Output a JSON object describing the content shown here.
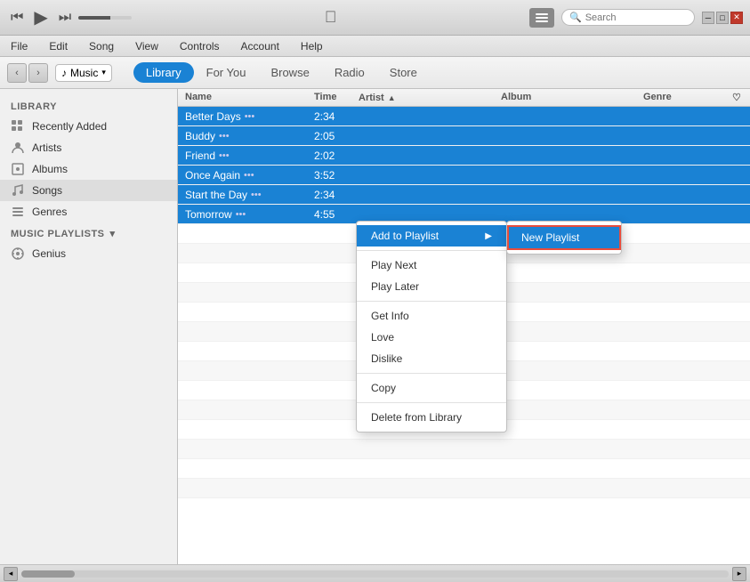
{
  "titlebar": {
    "transport": {
      "prev": "⏮",
      "play": "▶",
      "next": "⏭"
    },
    "apple_logo": "",
    "list_icon_label": "list",
    "search_placeholder": "Search"
  },
  "menubar": {
    "items": [
      "File",
      "Edit",
      "Song",
      "View",
      "Controls",
      "Account",
      "Help"
    ]
  },
  "navbar": {
    "nav_back": "‹",
    "nav_forward": "›",
    "source": "Music",
    "tabs": [
      "Library",
      "For You",
      "Browse",
      "Radio",
      "Store"
    ],
    "active_tab": "Library"
  },
  "sidebar": {
    "section_library": "Library",
    "items": [
      {
        "id": "recently-added",
        "label": "Recently Added",
        "icon": "grid"
      },
      {
        "id": "artists",
        "label": "Artists",
        "icon": "person"
      },
      {
        "id": "albums",
        "label": "Albums",
        "icon": "album"
      },
      {
        "id": "songs",
        "label": "Songs",
        "icon": "note",
        "selected": true
      },
      {
        "id": "genres",
        "label": "Genres",
        "icon": "bars"
      }
    ],
    "section_playlists": "Music Playlists",
    "genius": {
      "label": "Genius",
      "icon": "atom"
    }
  },
  "table": {
    "columns": [
      "Name",
      "Time",
      "Artist",
      "Album",
      "Genre",
      "♡"
    ],
    "rows": [
      {
        "name": "Better Days",
        "ellipsis": "•••",
        "time": "2:34",
        "artist": "",
        "album": "",
        "genre": "",
        "selected": true
      },
      {
        "name": "Buddy",
        "ellipsis": "•••",
        "time": "2:05",
        "artist": "",
        "album": "",
        "genre": "",
        "selected": true
      },
      {
        "name": "Friend",
        "ellipsis": "•••",
        "time": "2:02",
        "artist": "",
        "album": "",
        "genre": "",
        "selected": true
      },
      {
        "name": "Once Again",
        "ellipsis": "•••",
        "time": "3:52",
        "artist": "",
        "album": "",
        "genre": "",
        "selected": true
      },
      {
        "name": "Start the Day",
        "ellipsis": "•••",
        "time": "2:34",
        "artist": "",
        "album": "",
        "genre": "",
        "selected": true
      },
      {
        "name": "Tomorrow",
        "ellipsis": "•••",
        "time": "4:55",
        "artist": "",
        "album": "",
        "genre": "",
        "selected": true
      },
      {
        "name": "",
        "ellipsis": "",
        "time": "",
        "artist": "",
        "album": "",
        "genre": "",
        "selected": false
      },
      {
        "name": "",
        "ellipsis": "",
        "time": "",
        "artist": "",
        "album": "",
        "genre": "",
        "selected": false
      },
      {
        "name": "",
        "ellipsis": "",
        "time": "",
        "artist": "",
        "album": "",
        "genre": "",
        "selected": false
      },
      {
        "name": "",
        "ellipsis": "",
        "time": "",
        "artist": "",
        "album": "",
        "genre": "",
        "selected": false
      },
      {
        "name": "",
        "ellipsis": "",
        "time": "",
        "artist": "",
        "album": "",
        "genre": "",
        "selected": false
      },
      {
        "name": "",
        "ellipsis": "",
        "time": "",
        "artist": "",
        "album": "",
        "genre": "",
        "selected": false
      },
      {
        "name": "",
        "ellipsis": "",
        "time": "",
        "artist": "",
        "album": "",
        "genre": "",
        "selected": false
      },
      {
        "name": "",
        "ellipsis": "",
        "time": "",
        "artist": "",
        "album": "",
        "genre": "",
        "selected": false
      }
    ]
  },
  "context_menu": {
    "items": [
      {
        "id": "add-to-playlist",
        "label": "Add to Playlist",
        "has_submenu": true
      },
      {
        "id": "play-next",
        "label": "Play Next",
        "has_submenu": false
      },
      {
        "id": "play-later",
        "label": "Play Later",
        "has_submenu": false
      },
      {
        "separator1": true
      },
      {
        "id": "get-info",
        "label": "Get Info",
        "has_submenu": false
      },
      {
        "id": "love",
        "label": "Love",
        "has_submenu": false
      },
      {
        "id": "dislike",
        "label": "Dislike",
        "has_submenu": false
      },
      {
        "separator2": true
      },
      {
        "id": "copy",
        "label": "Copy",
        "has_submenu": false
      },
      {
        "separator3": true
      },
      {
        "id": "delete-from-library",
        "label": "Delete from Library",
        "has_submenu": false
      }
    ],
    "submenu": {
      "items": [
        {
          "id": "new-playlist",
          "label": "New Playlist",
          "highlighted": true
        }
      ]
    }
  },
  "statusbar": {
    "scroll_left": "◂",
    "scroll_right": "▸"
  },
  "colors": {
    "selected_blue": "#1a82d4",
    "highlight_red": "#e74c3c"
  }
}
